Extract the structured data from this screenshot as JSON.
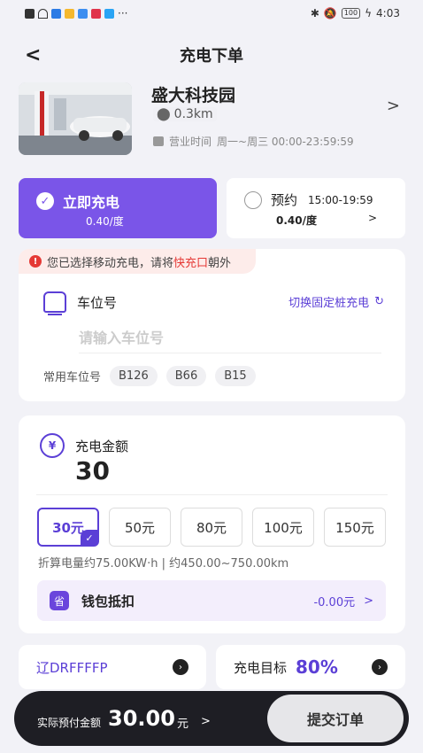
{
  "status_bar": {
    "time": "4:03",
    "battery": "100"
  },
  "header": {
    "title": "充电下单",
    "back_glyph": "<"
  },
  "station": {
    "name": "盛大科技园",
    "distance": "0.3km",
    "hours_label": "营业时间",
    "hours": "周一~周三 00:00-23:59:59",
    "arrow": ">"
  },
  "mode": {
    "now": {
      "label": "立即充电",
      "price": "0.40/度",
      "selected": true
    },
    "book": {
      "label": "预约",
      "time": "15:00-19:59",
      "price": "0.40/度",
      "arrow": ">",
      "selected": false
    }
  },
  "slot": {
    "warning_pre": "您已选择移动充电，请将",
    "warning_hl": "快充口",
    "warning_post": "朝外",
    "title": "车位号",
    "switch_label": "切换固定桩充电",
    "placeholder": "请输入车位号",
    "common_label": "常用车位号",
    "common": [
      "B126",
      "B66",
      "B15"
    ]
  },
  "amount": {
    "title": "充电金额",
    "value": "30",
    "options": [
      "30元",
      "50元",
      "80元",
      "100元",
      "150元"
    ],
    "selected_index": 0,
    "estimate": "折算电量约75.00KW·h | 约450.00~750.00km",
    "wallet_icon": "省",
    "wallet_label": "钱包抵扣",
    "wallet_value": "-0.00元",
    "wallet_arrow": ">"
  },
  "bottom": {
    "plate": "辽DRFFFFP",
    "target_label": "充电目标",
    "target_value": "80%"
  },
  "pay": {
    "label": "实际预付金额",
    "amount": "30.00",
    "unit": "元",
    "arrow": ">",
    "submit": "提交订单"
  },
  "colors": {
    "accent": "#7a55e8",
    "accent_dark": "#5b3fd6",
    "warning": "#e53935",
    "pay_bar": "#1e1e24"
  }
}
